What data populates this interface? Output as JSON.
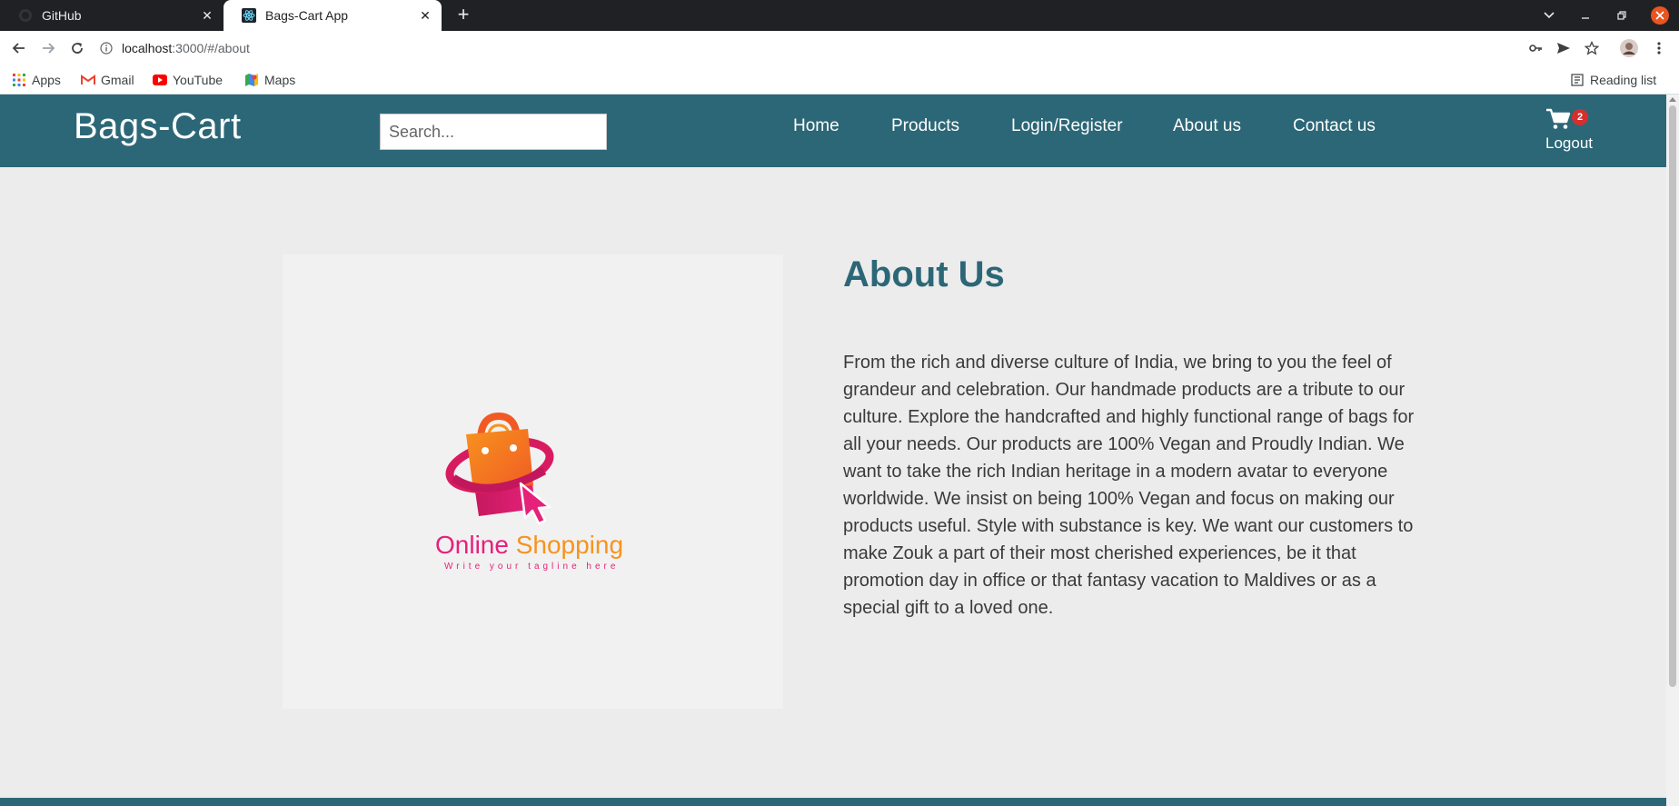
{
  "browser": {
    "tabs": [
      {
        "title": "GitHub",
        "icon": "github-icon",
        "active": false
      },
      {
        "title": "Bags-Cart App",
        "icon": "react-icon",
        "active": true
      }
    ],
    "url_host": "localhost",
    "url_rest": ":3000/#/about",
    "bookmarks": [
      {
        "label": "Apps",
        "icon": "apps-grid-icon"
      },
      {
        "label": "Gmail",
        "icon": "gmail-icon"
      },
      {
        "label": "YouTube",
        "icon": "youtube-icon"
      },
      {
        "label": "Maps",
        "icon": "maps-icon"
      }
    ],
    "reading_list": "Reading list"
  },
  "site": {
    "brand": "Bags-Cart",
    "search_placeholder": "Search...",
    "nav": [
      {
        "label": "Home"
      },
      {
        "label": "Products"
      },
      {
        "label": "Login/Register"
      },
      {
        "label": "About us"
      },
      {
        "label": "Contact us"
      }
    ],
    "cart_count": "2",
    "logout": "Logout"
  },
  "about": {
    "title": "About Us",
    "body": "From the rich and diverse culture of India, we bring to you the feel of grandeur and celebration. Our handmade products are a tribute to our culture. Explore the handcrafted and highly functional range of bags for all your needs. Our products are 100% Vegan and Proudly Indian. We want to take the rich Indian heritage in a modern avatar to everyone worldwide. We insist on being 100% Vegan and focus on making our products useful. Style with substance is key. We want our customers to make Zouk a part of their most cherished experiences, be it that promotion day in office or that fantasy vacation to Maldives or as a special gift to a loved one.",
    "logo_word1": "Online",
    "logo_word2": "Shopping",
    "logo_tagline": "Write your tagline here"
  },
  "colors": {
    "brand_teal": "#2c6777",
    "badge_red": "#d32f2f",
    "logo_pink": "#e6217a",
    "logo_orange": "#f7931e"
  }
}
